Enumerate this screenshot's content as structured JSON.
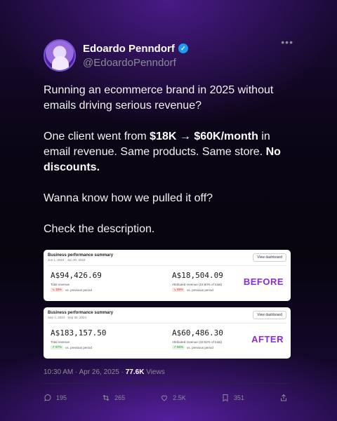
{
  "author": {
    "display_name": "Edoardo Penndorf",
    "handle": "@EdoardoPenndorf",
    "verified_icon": "verified-badge-icon"
  },
  "post": {
    "paragraph1": "Running an ecommerce brand in 2025 without emails driving serious revenue?",
    "paragraph2_prefix": "One client went from ",
    "paragraph2_bold1": "$18K → $60K/month",
    "paragraph2_middle": " in email revenue. Same products. Same store. ",
    "paragraph2_bold2": "No discounts.",
    "paragraph3": "Wanna know how we pulled it off?",
    "paragraph4": "Check the description."
  },
  "cards": [
    {
      "title": "Business performance summary",
      "date_range": "Jun 1, 2024 - Jun 30, 2024",
      "button": "View dashboard",
      "total_value": "A$94,426.69",
      "total_label": "Total revenue",
      "total_change": "18%",
      "total_change_note": "vs. previous period",
      "attributed_value": "A$18,504.09",
      "attributed_label": "Attributed revenue (19.60% of total)",
      "attributed_change": "69%",
      "attributed_change_note": "vs. previous period",
      "tag": "BEFORE"
    },
    {
      "title": "Business performance summary",
      "date_range": "Sep 1, 2024 - Sep 30, 2024",
      "button": "View dashboard",
      "total_value": "A$183,157.50",
      "total_label": "Total revenue",
      "total_change": "97%",
      "total_change_note": "vs. previous period",
      "attributed_value": "A$60,486.30",
      "attributed_label": "Attributed revenue (33.02% of total)",
      "attributed_change": "96%",
      "attributed_change_note": "vs. previous period",
      "tag": "AFTER"
    }
  ],
  "meta": {
    "timestamp": "10:30 AM · Apr 26, 2025 · ",
    "views_count": "77.6K",
    "views_label": " Views"
  },
  "actions": {
    "replies": "195",
    "reposts": "265",
    "likes": "2.5K",
    "bookmarks": "351"
  },
  "colors": {
    "accent_purple": "#8a2be2",
    "verified_blue": "#1d9bf0"
  }
}
